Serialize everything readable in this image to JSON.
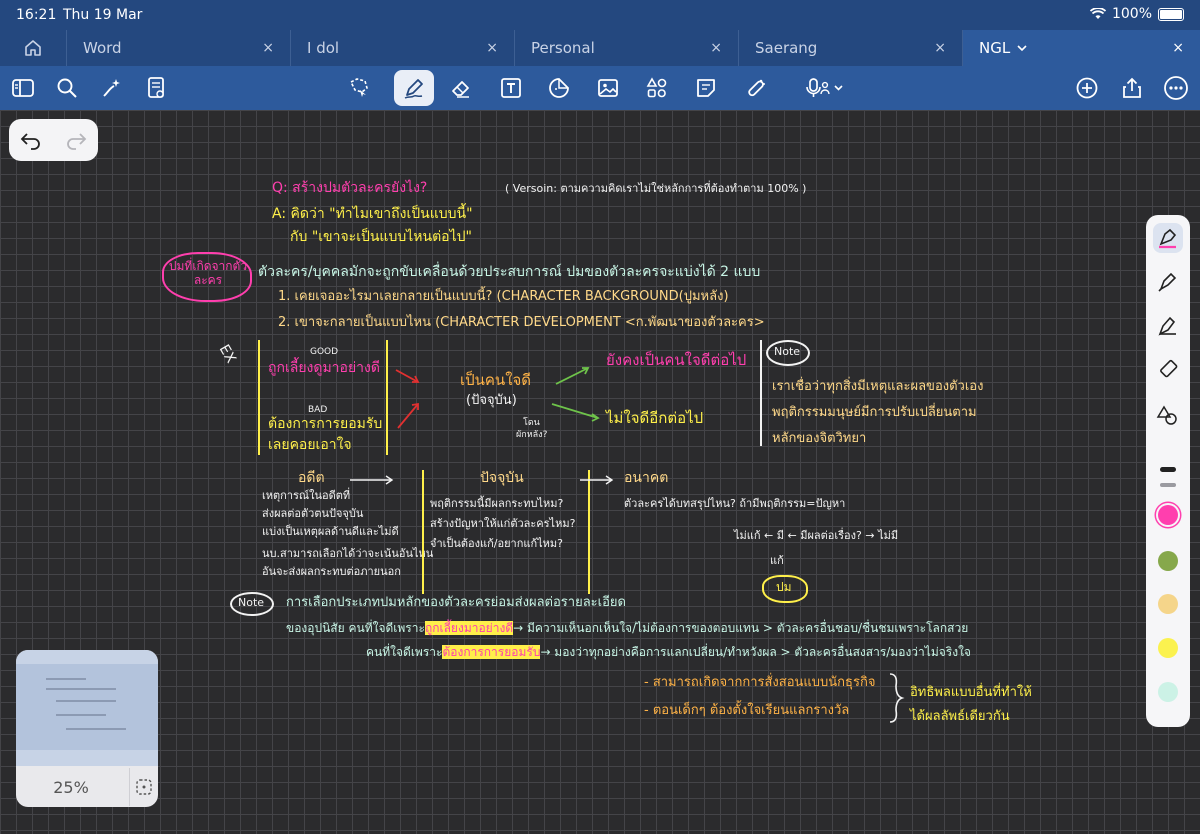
{
  "status": {
    "time": "16:21",
    "date": "Thu 19 Mar",
    "battery": "100%"
  },
  "tabs": [
    {
      "label": "Word",
      "active": false
    },
    {
      "label": "I dol",
      "active": false
    },
    {
      "label": "Personal",
      "active": false
    },
    {
      "label": "Saerang",
      "active": false
    },
    {
      "label": "NGL",
      "active": true
    }
  ],
  "close_glyph": "×",
  "minimap": {
    "zoom": "25%"
  },
  "note": {
    "question": "Q: สร้างปมตัวละครยังไง?",
    "version": "( Versoin: ตามความคิดเราไม่ใช่หลักการที่ต้องทำตาม 100% )",
    "answer1": "A: คิดว่า \"ทำไมเขาถึงเป็นแบบนี้\"",
    "answer2": "กับ \"เขาจะเป็นแบบไหนต่อไป\"",
    "cloud_label": "ปมที่เกิดจากตัวละคร",
    "intro": "ตัวละคร/บุคคลมักจะถูกขับเคลื่อนด้วยประสบการณ์ ปมของตัวละครจะแบ่งได้ 2 แบบ",
    "type1": "1. เคยเจออะไรมาเลยกลายเป็นแบบนี้? (CHARACTER BACKGROUND(ปูมหลัง)",
    "type2": "2. เขาจะกลายเป็นแบบไหน (CHARACTER DEVELOPMENT <ก.พัฒนาของตัวละคร>",
    "ex": "EX",
    "good": "GOOD",
    "good_text": "ถูกเลี้ยงดูมาอย่างดี",
    "bad": "BAD",
    "bad_text1": "ต้องการการยอมรับ",
    "bad_text2": "เลยคอยเอาใจ",
    "center1": "เป็นคนใจดี",
    "center2": "(ปัจจุบัน)",
    "center3": "โดน",
    "center4": "ผักหลัง?",
    "result1": "ยังคงเป็นคนใจดีต่อไป",
    "result2": "ไม่ใจดีอีกต่อไป",
    "note_label": "Note",
    "note1": "เราเชื่อว่าทุกสิ่งมีเหตุและผลของตัวเอง",
    "note2": "พฤติกรรมมนุษย์มีการปรับเปลี่ยนตาม",
    "note3": "หลักของจิตวิทยา",
    "past": "อดีต",
    "past1": "เหตุการณ์ในอดีตที่",
    "past2": "ส่งผลต่อตัวตนปัจจุบัน",
    "past3": "แบ่งเป็นเหตุผลด้านดีและไม่ดี",
    "past4": "นบ.สามารถเลือกได้ว่าจะเน้นอันไหน",
    "past5": "อันจะส่งผลกระทบต่อภายนอก",
    "present": "ปัจจุบัน",
    "present1": "พฤติกรรมนี้มีผลกระทบไหม?",
    "present2": "สร้างปัญหาให้แก่ตัวละครไหม?",
    "present3": "จำเป็นต้องแก้/อยากแก้ไหม?",
    "future": "อนาคต",
    "future1": "ตัวละครได้บทสรุปไหน? ถ้ามีพฤติกรรม=ปัญหา",
    "future2a": "ไม่แก้ ← มี ← มีผลต่อเรื่อง? → ไม่มี",
    "future3": "แก้",
    "future_cloud": "ปม",
    "note_b1": "การเลือกประเภทปมหลักของตัวละครย่อมส่งผลต่อรายละเอียด",
    "note_b2a": "ของอุปนิสัย  คนที่ใจดีเพราะ",
    "note_b2hl": "ถูกเลี้ยงมาอย่างดี",
    "note_b2b": "→ มีความเห็นอกเห็นใจ/ไม่ต้องการของตอบแทน > ตัวละครอื่นชอบ/ชื่นชมเพราะโลกสวย",
    "note_b3a": "คนที่ใจดีเพราะ",
    "note_b3hl": "ต้องการการยอมรับ",
    "note_b3b": "→ มองว่าทุกอย่างคือการแลกเปลี่ยน/ทำหวังผล > ตัวละครอื่นสงสาร/มองว่าไม่จริงใจ",
    "sub1": "- สามารถเกิดจากการสั่งสอนแบบนักธุรกิจ",
    "sub2": "- ตอนเด็กๆ ต้องตั้งใจเรียนแลกรางวัล",
    "sub_right1": "อิทธิพลแบบอื่นที่ทำให้",
    "sub_right2": "ได้ผลลัพธ์เดียวกัน"
  },
  "colors": {
    "brand_dark": "#24487f",
    "brand": "#2d5a9c",
    "pink": "#ff3fae",
    "yellow": "#fff04a"
  }
}
